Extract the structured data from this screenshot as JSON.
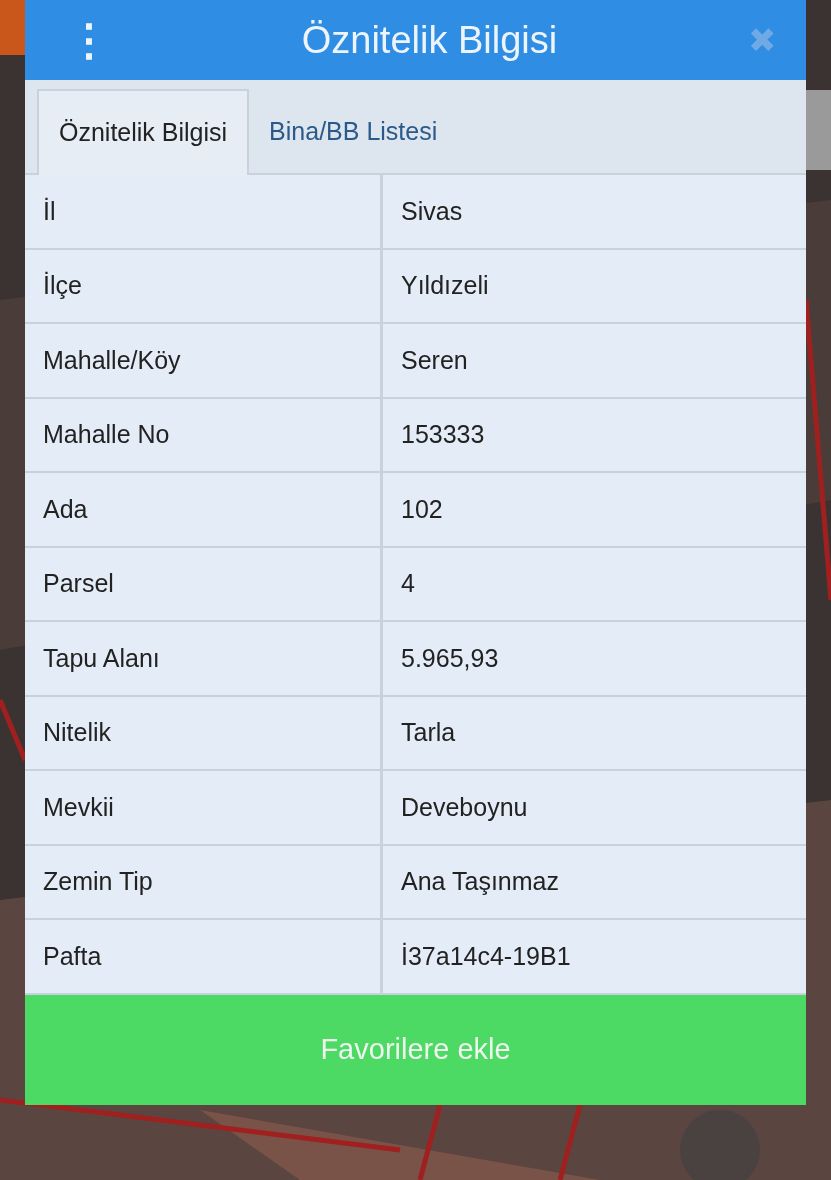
{
  "dialog": {
    "title": "Öznitelik Bilgisi",
    "menu_icon": "⋮",
    "close_icon": "✖"
  },
  "tabs": [
    {
      "label": "Öznitelik Bilgisi",
      "selected": true
    },
    {
      "label": "Bina/BB Listesi",
      "selected": false
    }
  ],
  "table": {
    "rows": [
      {
        "label": "İl",
        "value": "Sivas"
      },
      {
        "label": "İlçe",
        "value": "Yıldızeli"
      },
      {
        "label": "Mahalle/Köy",
        "value": "Seren"
      },
      {
        "label": "Mahalle No",
        "value": "153333"
      },
      {
        "label": "Ada",
        "value": "102"
      },
      {
        "label": "Parsel",
        "value": "4"
      },
      {
        "label": "Tapu Alanı",
        "value": "5.965,93"
      },
      {
        "label": "Nitelik",
        "value": "Tarla"
      },
      {
        "label": "Mevkii",
        "value": "Deveboynu"
      },
      {
        "label": "Zemin Tip",
        "value": "Ana Taşınmaz"
      },
      {
        "label": "Pafta",
        "value": "İ37a14c4-19B1"
      }
    ]
  },
  "button": {
    "label": "Favorilere ekle"
  }
}
